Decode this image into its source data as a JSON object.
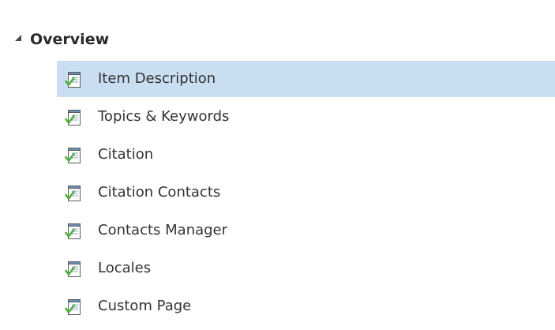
{
  "tree": {
    "group": {
      "label": "Overview",
      "expanded": true,
      "expander_icon": "collapse-triangle-icon"
    },
    "items": [
      {
        "label": "Item Description",
        "icon": "metadata-page-check-icon",
        "selected": true
      },
      {
        "label": "Topics & Keywords",
        "icon": "metadata-page-check-icon",
        "selected": false
      },
      {
        "label": "Citation",
        "icon": "metadata-page-check-icon",
        "selected": false
      },
      {
        "label": "Citation Contacts",
        "icon": "metadata-page-check-icon",
        "selected": false
      },
      {
        "label": "Contacts Manager",
        "icon": "metadata-page-check-icon",
        "selected": false
      },
      {
        "label": "Locales",
        "icon": "metadata-page-check-icon",
        "selected": false
      },
      {
        "label": "Custom Page",
        "icon": "metadata-page-check-icon",
        "selected": false
      }
    ],
    "colors": {
      "selection": "#c9def1",
      "check": "#4caf3c",
      "text": "#333333"
    }
  }
}
